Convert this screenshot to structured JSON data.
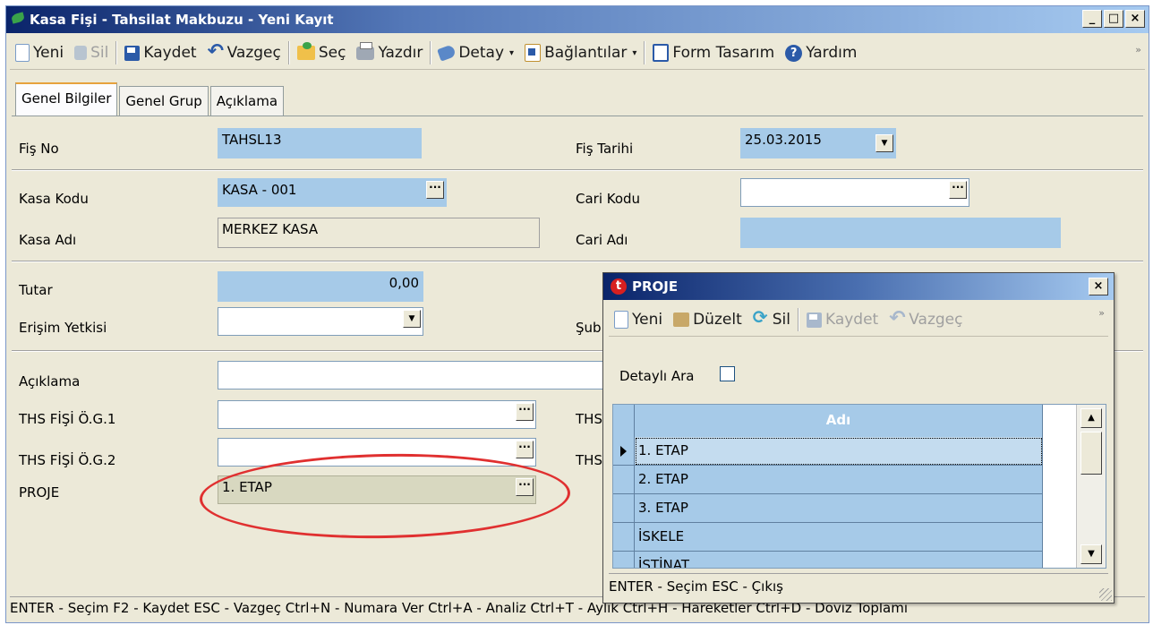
{
  "window": {
    "title": "Kasa Fişi - Tahsilat Makbuzu - Yeni Kayıt",
    "buttons": {
      "minimize": "_",
      "maximize": "□",
      "close": "×"
    }
  },
  "toolbar": {
    "new_label": "Yeni",
    "delete_label": "Sil",
    "save_label": "Kaydet",
    "cancel_label": "Vazgeç",
    "select_label": "Seç",
    "print_label": "Yazdır",
    "detail_label": "Detay",
    "links_label": "Bağlantılar",
    "form_design_label": "Form Tasarım",
    "help_label": "Yardım",
    "overflow": "»"
  },
  "tabs": [
    {
      "label": "Genel Bilgiler"
    },
    {
      "label": "Genel Grup"
    },
    {
      "label": "Açıklama"
    }
  ],
  "form": {
    "fis_no_label": "Fiş No",
    "fis_no_value": "TAHSL13",
    "fis_tarihi_label": "Fiş Tarihi",
    "fis_tarihi_value": "25.03.2015",
    "kasa_kodu_label": "Kasa Kodu",
    "kasa_kodu_value": "KASA - 001",
    "cari_kodu_label": "Cari Kodu",
    "cari_kodu_value": "",
    "kasa_adi_label": "Kasa Adı",
    "kasa_adi_value": "MERKEZ KASA",
    "cari_adi_label": "Cari Adı",
    "cari_adi_value": "",
    "tutar_label": "Tutar",
    "tutar_value": "0,00",
    "erisim_label": "Erişim Yetkisi",
    "erisim_value": "",
    "sube_label_partial": "Şub",
    "aciklama_label": "Açıklama",
    "aciklama_value": "",
    "og1_label": "THS FİŞİ Ö.G.1",
    "og1_value": "",
    "og2_label": "THS FİŞİ Ö.G.2",
    "og2_value": "",
    "ths_right1_partial": "THS",
    "ths_right2_partial": "THS",
    "proje_label": "PROJE",
    "proje_value": "1. ETAP",
    "ellipsis": "···",
    "dropdown_arrow": "▼"
  },
  "statusbar": {
    "text": "ENTER - Seçim  F2 - Kaydet  ESC - Vazgeç   Ctrl+N - Numara Ver    Ctrl+A - Analiz  Ctrl+T - Aylık  Ctrl+H - Hareketler  Ctrl+D - Döviz Toplamı"
  },
  "popup": {
    "title": "PROJE",
    "logo": "t",
    "close": "×",
    "toolbar": {
      "new_label": "Yeni",
      "edit_label": "Düzelt",
      "delete_label": "Sil",
      "save_label": "Kaydet",
      "cancel_label": "Vazgeç",
      "overflow": "»"
    },
    "detailed_search_label": "Detaylı Ara",
    "grid": {
      "column_header": "Adı",
      "rows": [
        "1. ETAP",
        "2. ETAP",
        "3. ETAP",
        "İSKELE",
        "İSTİNAT"
      ]
    },
    "scroll_up": "▲",
    "scroll_down": "▼",
    "status": "ENTER - Seçim  ESC - Çıkış"
  }
}
